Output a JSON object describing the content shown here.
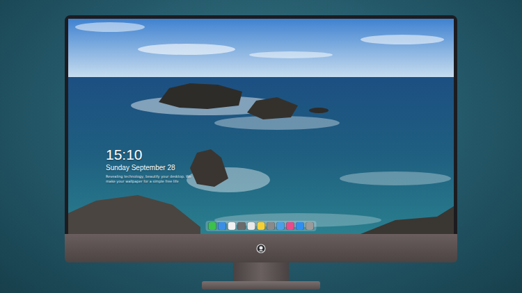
{
  "screen": {
    "clock": "15:10",
    "date": "Sunday September 28",
    "tagline": [
      "Revealing technology, beautify your desktop. We",
      "make your wallpaper for a simple free life"
    ]
  },
  "dock": {
    "items": [
      {
        "color": "#3cc24a"
      },
      {
        "color": "#3a8ee6"
      },
      {
        "color": "#f2f2f2"
      },
      {
        "color": "#6b6b6b"
      },
      {
        "color": "#e8e8e8"
      },
      {
        "color": "#f5d033"
      },
      {
        "color": "#8a8a8a"
      },
      {
        "color": "#4aa0e8"
      },
      {
        "color": "#e84a8a"
      },
      {
        "color": "#2f8ff0"
      },
      {
        "color": "#9a9a9a"
      }
    ]
  }
}
